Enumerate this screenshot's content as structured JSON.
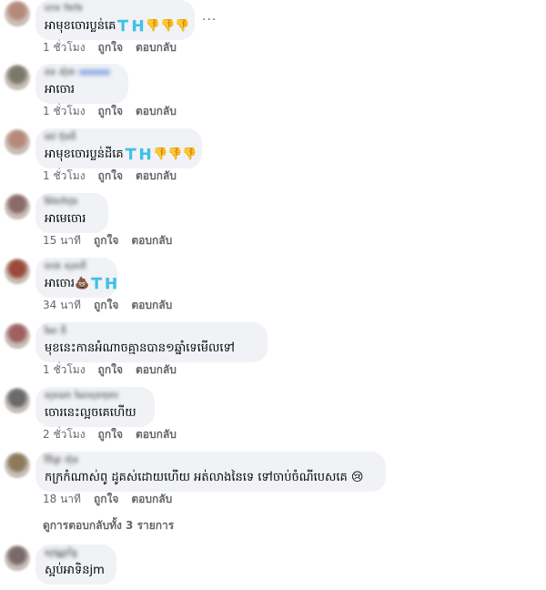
{
  "comments": [
    {
      "author": "ম্যাক জিত্তি",
      "badge": false,
      "text": "អាមុខចោរប្លន់គេ🇹🇭👎👎👎",
      "time": "1 ชั่วโมง",
      "like": "ถูกใจ",
      "reply": "ตอบกลับ",
      "avatar_color": "#b58a7a"
    },
    {
      "author": "ដន ស៊ុខា",
      "badge": true,
      "text": "អាចោរ",
      "time": "1 ชั่วโมง",
      "like": "ถูกใจ",
      "reply": "ตอบกลับ",
      "avatar_color": "#7a7a6a"
    },
    {
      "author": "ដេវ ប៊ុនធី",
      "badge": false,
      "text": "អាមុខចោរប្លន់ដីគេ🇹🇭👎👎👎",
      "time": "1 ชั่วโมง",
      "like": "ถูกใจ",
      "reply": "ตอบกลับ",
      "avatar_color": "#b58a7a"
    },
    {
      "author": "ម៉ែងហ៊ាវុធ",
      "badge": false,
      "text": "អាមេចោរ",
      "time": "15 นาที",
      "like": "ถูกใจ",
      "reply": "ตอบกลับ",
      "avatar_color": "#8a6a6a"
    },
    {
      "author": "ហេង សុខលី",
      "badge": false,
      "text": "អាចោរ💩🇹🇭",
      "time": "34 นาที",
      "like": "ถูกใจ",
      "reply": "ตอบกลับ",
      "avatar_color": "#9a4a3a"
    },
    {
      "author": "ណៃ ធី",
      "badge": false,
      "text": "មុខនេះកានអំណាចគ្មានបាន១ឆ្នាំទេមើលទៅ",
      "time": "1 ชั่วโมง",
      "like": "ถูกใจ",
      "reply": "ตอบกลับ",
      "avatar_color": "#a06060"
    },
    {
      "author": "សុខណា ណៃសុខកុមារ",
      "badge": false,
      "text": "ចោរនេះល្អចគេហើយ",
      "time": "2 ชั่วโมง",
      "like": "ถูกใจ",
      "reply": "ตอบกลับ",
      "avatar_color": "#6a6a6a"
    },
    {
      "author": "វិចិត្រ ហ៊ុន",
      "badge": false,
      "text": "កក្រកំណាស់ពូ ដូគស់ដោយហើយ អត់លាងនៃទេ ទៅចាប់ចំណីបេសគេ 😢",
      "time": "18 นาที",
      "like": "ถูกใจ",
      "reply": "ตอบกลับ",
      "avatar_color": "#8a7a5a"
    },
    {
      "author": "សុវណ្ណារិទ្ធ",
      "badge": false,
      "text": "ស្អប់អាទិនjm",
      "time": "",
      "like": "",
      "reply": "",
      "avatar_color": "#7a6a6a"
    }
  ],
  "view_replies": "ดูการตอบกลับทั้ง 3 รายการ",
  "more_options": "..."
}
